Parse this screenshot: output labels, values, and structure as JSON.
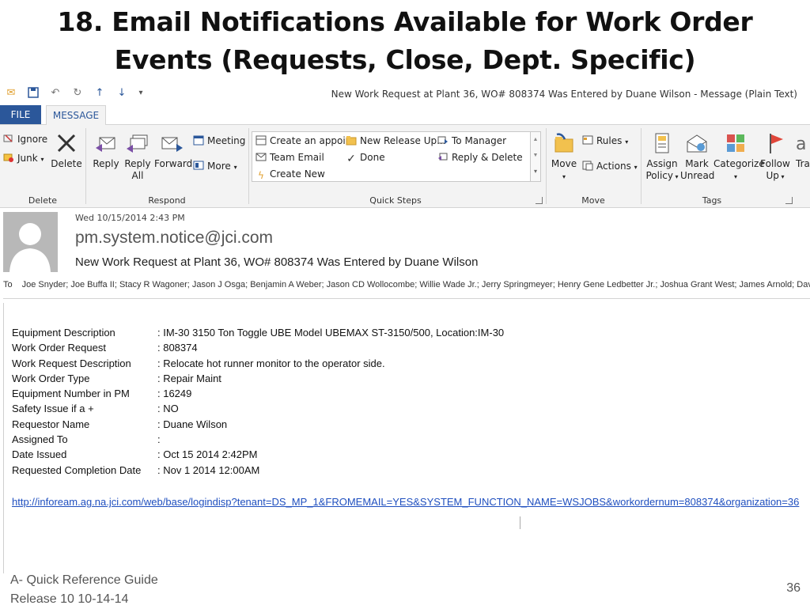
{
  "slide": {
    "title_line1": "18. Email Notifications Available for Work Order",
    "title_line2": "Events (Requests, Close, Dept. Specific)",
    "footer_line1": "A- Quick Reference Guide",
    "footer_line2": "Release 10 10-14-14",
    "page_number": "36"
  },
  "window": {
    "title": "New Work Request at Plant 36, WO# 808374 Was Entered by Duane Wilson - Message (Plain Text)"
  },
  "tabs": {
    "file": "FILE",
    "message": "MESSAGE"
  },
  "ribbon": {
    "delete_group": {
      "label": "Delete",
      "ignore": "Ignore",
      "junk": "Junk",
      "delete": "Delete"
    },
    "respond_group": {
      "label": "Respond",
      "reply": "Reply",
      "reply_all_1": "Reply",
      "reply_all_2": "All",
      "forward": "Forward",
      "meeting": "Meeting",
      "more": "More"
    },
    "quick_steps": {
      "label": "Quick Steps",
      "items": [
        "Create an appoi...",
        "Team Email",
        "Create New",
        "New Release Up...",
        "Done",
        "To Manager",
        "Reply & Delete"
      ]
    },
    "move_group": {
      "label": "Move",
      "move": "Move",
      "rules": "Rules",
      "actions": "Actions"
    },
    "tags_group": {
      "label": "Tags",
      "assign_1": "Assign",
      "assign_2": "Policy",
      "mark_1": "Mark",
      "mark_2": "Unread",
      "categorize": "Categorize",
      "follow_1": "Follow",
      "follow_2": "Up",
      "trans": "Tra"
    }
  },
  "message": {
    "date": "Wed 10/15/2014 2:43 PM",
    "from": "pm.system.notice@jci.com",
    "subject": "New Work Request at Plant 36, WO# 808374 Was Entered by Duane Wilson",
    "to_label": "To",
    "to": "Joe Snyder; Joe Buffa II; Stacy R Wagoner; Jason J Osga; Benjamin A Weber; Jason CD Wollocombe; Willie Wade Jr.; Jerry Springmeyer; Henry Gene Ledbetter Jr.; Joshua Grant West; James Arnold; David Dee Spra",
    "fields": [
      {
        "label": "Equipment Description",
        "value": ": IM-30 3150 Ton Toggle UBE Model UBEMAX ST-3150/500, Location:IM-30"
      },
      {
        "label": "Work Order Request",
        "value": ": 808374"
      },
      {
        "label": "Work Request Description",
        "value": ": Relocate hot runner monitor to the operator side."
      },
      {
        "label": "Work Order Type",
        "value": ": Repair Maint"
      },
      {
        "label": "Equipment Number in PM",
        "value": ": 16249"
      },
      {
        "label": "Safety Issue if a +",
        "value": ": NO"
      },
      {
        "label": "Requestor Name",
        "value": ": Duane Wilson"
      },
      {
        "label": "Assigned To",
        "value": ":"
      },
      {
        "label": "Date Issued",
        "value": ": Oct 15 2014  2:42PM"
      },
      {
        "label": "Requested Completion Date",
        "value": ": Nov  1 2014 12:00AM"
      }
    ],
    "link": "http://infoream.ag.na.jci.com/web/base/logindisp?tenant=DS_MP_1&FROMEMAIL=YES&SYSTEM_FUNCTION_NAME=WSJOBS&workordernum=808374&organization=36"
  }
}
